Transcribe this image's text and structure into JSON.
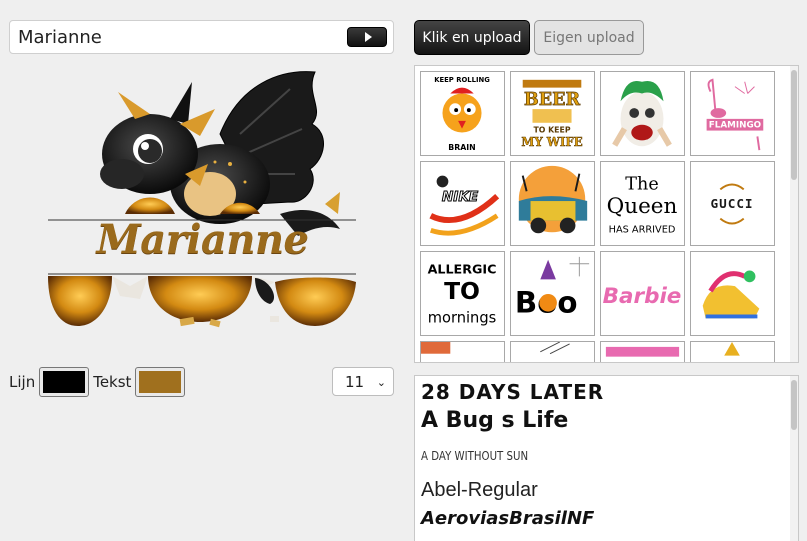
{
  "name_input": {
    "value": "Marianne"
  },
  "preview": {
    "name_text": "Marianne"
  },
  "controls": {
    "line_label": "Lijn",
    "line_color": "#000000",
    "text_label": "Tekst",
    "text_color": "#a0701e",
    "size_value": "11"
  },
  "upload": {
    "click_upload_label": "Klik en upload",
    "own_upload_label": "Eigen upload"
  },
  "gallery": {
    "tiles": [
      {
        "name": "rooster",
        "lines": [
          "KEEP ROLLING",
          "BRAIN"
        ]
      },
      {
        "name": "beer",
        "lines": [
          "BEER",
          "TO KEEP",
          "MY WIFE"
        ]
      },
      {
        "name": "joker",
        "lines": []
      },
      {
        "name": "flamingo",
        "lines": [
          "FLAMINGO"
        ]
      },
      {
        "name": "nike",
        "lines": [
          "NIKE"
        ]
      },
      {
        "name": "jeep",
        "lines": []
      },
      {
        "name": "queen",
        "lines": [
          "The",
          "Queen",
          "HAS ARRIVED"
        ]
      },
      {
        "name": "gucci",
        "lines": [
          "GUCCI"
        ]
      },
      {
        "name": "allergic",
        "lines": [
          "ALLERGIC",
          "TO",
          "mornings"
        ]
      },
      {
        "name": "boo",
        "lines": [
          "Boo"
        ]
      },
      {
        "name": "barbie",
        "lines": [
          "Barbie"
        ]
      },
      {
        "name": "sneaker",
        "lines": []
      }
    ]
  },
  "fonts": {
    "items": [
      "28 DAYS LATER",
      "A Bug s Life",
      "A DAY WITHOUT SUN",
      "Abel-Regular",
      "AeroviasBrasilNF"
    ]
  }
}
